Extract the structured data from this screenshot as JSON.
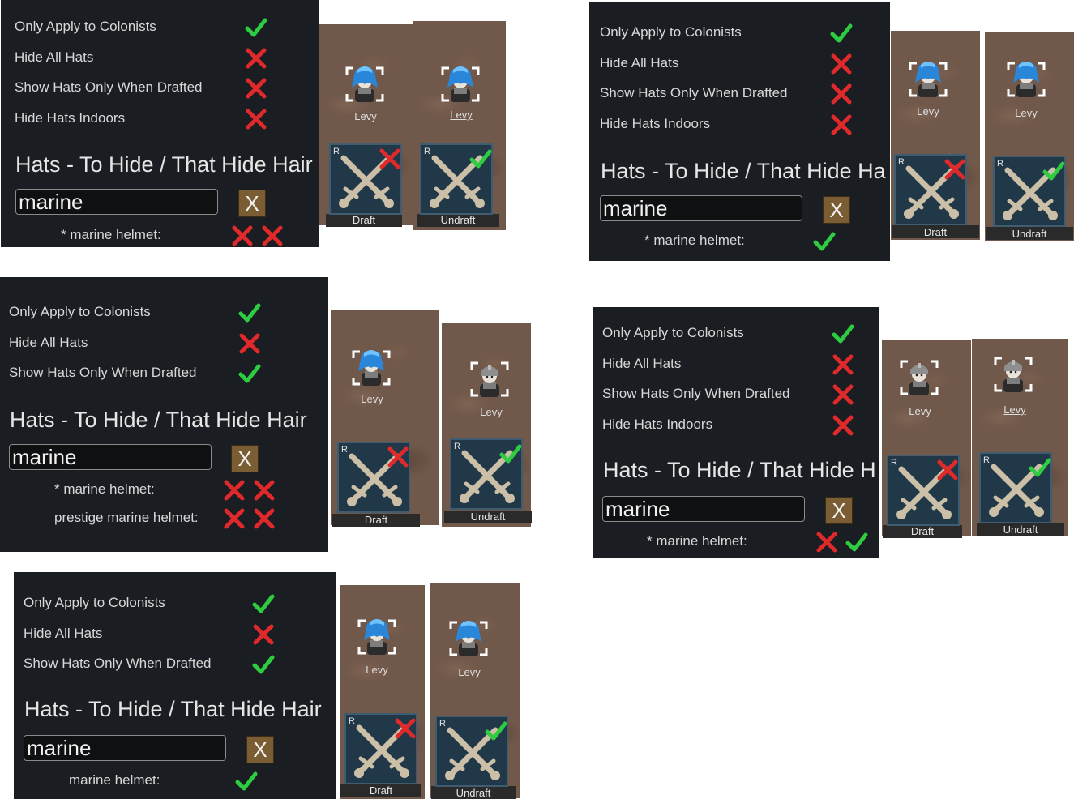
{
  "colors": {
    "check": "#2ecc40",
    "cross": "#e0292b",
    "panel_bg": "#1a1d21",
    "x_button": "#7a5d33"
  },
  "icons": {
    "check": "checkmark-icon",
    "cross": "cross-icon",
    "sword": "crossed-swords-icon"
  },
  "panels": [
    {
      "options": [
        {
          "label": "Only Apply to Colonists",
          "state": "check"
        },
        {
          "label": "Hide All Hats",
          "state": "cross"
        },
        {
          "label": "Show Hats Only When Drafted",
          "state": "cross"
        },
        {
          "label": "Hide Hats Indoors",
          "state": "cross"
        }
      ],
      "heading": "Hats - To Hide / That Hide Hair",
      "search_value": "marine",
      "clear_label": "X",
      "results": [
        {
          "label": "* marine helmet:",
          "states": [
            "cross",
            "cross"
          ]
        }
      ],
      "pawns": [
        {
          "name": "Levy",
          "hair": "blue"
        },
        {
          "name": "Levy",
          "hair": "blue"
        }
      ],
      "gizmos": [
        {
          "r": "R",
          "label": "Draft",
          "overlay": "cross"
        },
        {
          "r": "R",
          "label": "Undraft",
          "overlay": "check"
        }
      ]
    },
    {
      "options": [
        {
          "label": "Only Apply to Colonists",
          "state": "check"
        },
        {
          "label": "Hide All Hats",
          "state": "cross"
        },
        {
          "label": "Show Hats Only When Drafted",
          "state": "cross"
        },
        {
          "label": "Hide Hats Indoors",
          "state": "cross"
        }
      ],
      "heading": "Hats - To Hide / That Hide Ha",
      "search_value": "marine",
      "clear_label": "X",
      "results": [
        {
          "label": "* marine helmet:",
          "states": [
            "check"
          ]
        }
      ],
      "pawns": [
        {
          "name": "Levy",
          "hair": "blue"
        },
        {
          "name": "Levy",
          "hair": "blue"
        }
      ],
      "gizmos": [
        {
          "r": "R",
          "label": "Draft",
          "overlay": "cross"
        },
        {
          "r": "R",
          "label": "Undraft",
          "overlay": "check"
        }
      ]
    },
    {
      "options": [
        {
          "label": "Only Apply to Colonists",
          "state": "check"
        },
        {
          "label": "Hide All Hats",
          "state": "cross"
        },
        {
          "label": "Show Hats Only When Drafted",
          "state": "check"
        }
      ],
      "heading": "Hats - To Hide / That Hide Hair",
      "search_value": "marine",
      "clear_label": "X",
      "results": [
        {
          "label": "* marine helmet:",
          "states": [
            "cross",
            "cross"
          ]
        },
        {
          "label": "prestige marine helmet:",
          "states": [
            "cross",
            "cross"
          ]
        }
      ],
      "pawns": [
        {
          "name": "Levy",
          "hair": "blue"
        },
        {
          "name": "Levy",
          "hair": "helmet"
        }
      ],
      "gizmos": [
        {
          "r": "R",
          "label": "Draft",
          "overlay": "cross"
        },
        {
          "r": "R",
          "label": "Undraft",
          "overlay": "check"
        }
      ]
    },
    {
      "options": [
        {
          "label": "Only Apply to Colonists",
          "state": "check"
        },
        {
          "label": "Hide All Hats",
          "state": "cross"
        },
        {
          "label": "Show Hats Only When Drafted",
          "state": "cross"
        },
        {
          "label": "Hide Hats Indoors",
          "state": "cross"
        }
      ],
      "heading": "Hats - To Hide / That Hide H",
      "search_value": "marine",
      "clear_label": "X",
      "results": [
        {
          "label": "* marine helmet:",
          "states": [
            "cross",
            "check"
          ]
        }
      ],
      "pawns": [
        {
          "name": "Levy",
          "hair": "helmet"
        },
        {
          "name": "Levy",
          "hair": "helmet"
        }
      ],
      "gizmos": [
        {
          "r": "R",
          "label": "Draft",
          "overlay": "cross"
        },
        {
          "r": "R",
          "label": "Undraft",
          "overlay": "check"
        }
      ]
    },
    {
      "options": [
        {
          "label": "Only Apply to Colonists",
          "state": "check"
        },
        {
          "label": "Hide All Hats",
          "state": "cross"
        },
        {
          "label": "Show Hats Only When Drafted",
          "state": "check"
        }
      ],
      "heading": "Hats - To Hide / That Hide Hair",
      "search_value": "marine",
      "clear_label": "X",
      "results": [
        {
          "label": "marine helmet:",
          "states": [
            "check"
          ]
        }
      ],
      "pawns": [
        {
          "name": "Levy",
          "hair": "blue"
        },
        {
          "name": "Levy",
          "hair": "blue"
        }
      ],
      "gizmos": [
        {
          "r": "R",
          "label": "Draft",
          "overlay": "cross"
        },
        {
          "r": "R",
          "label": "Undraft",
          "overlay": "check"
        }
      ]
    }
  ]
}
